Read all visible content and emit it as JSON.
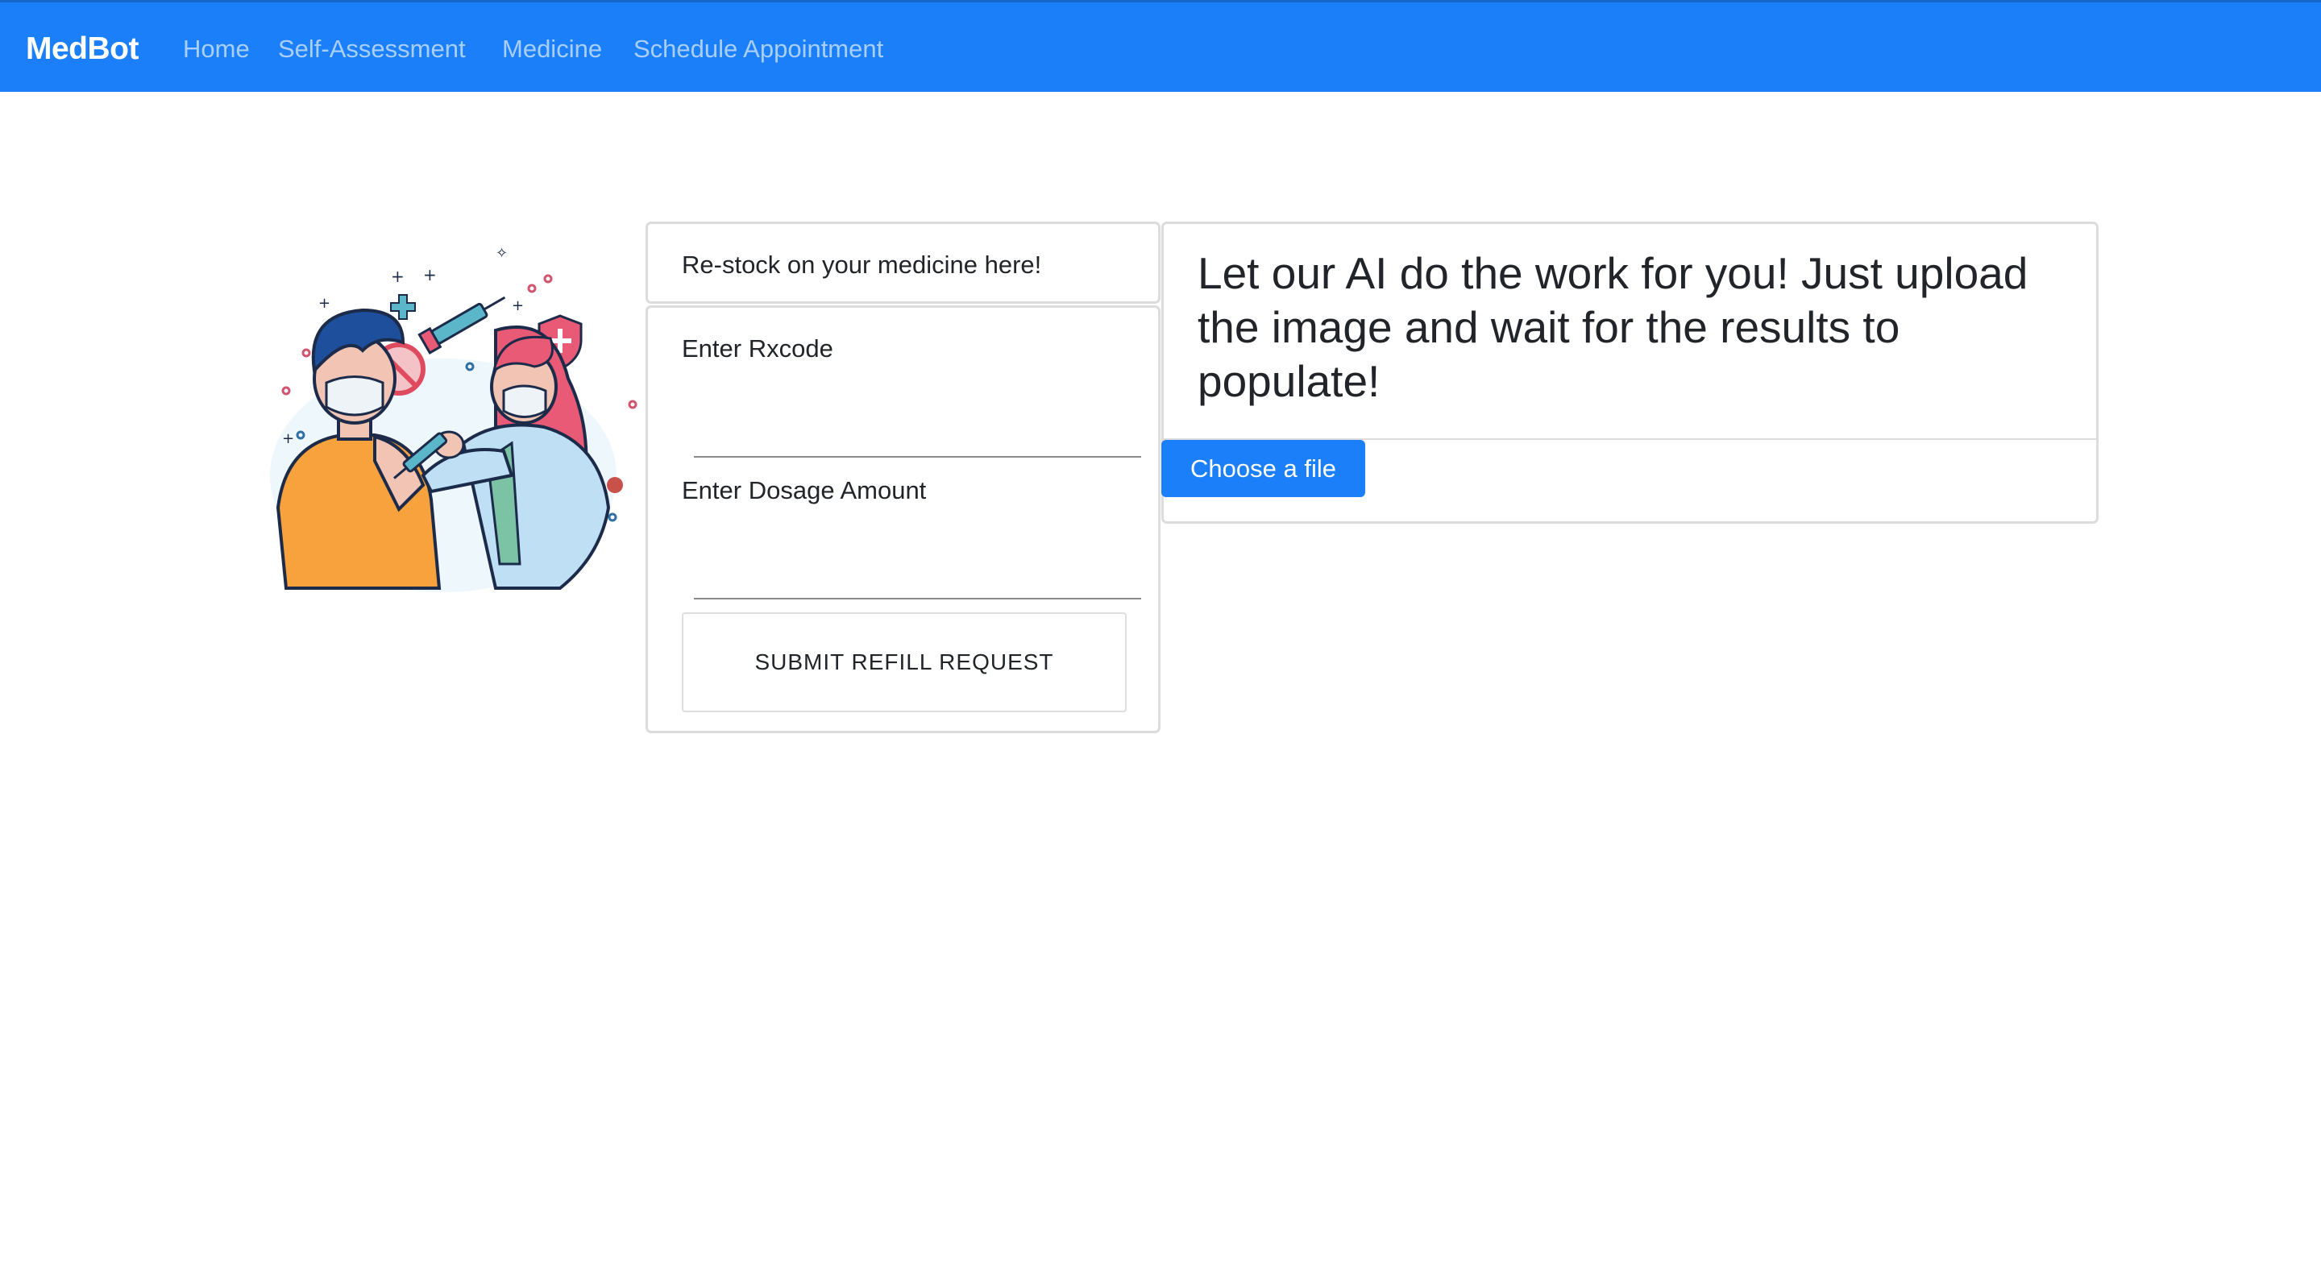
{
  "navbar": {
    "brand": "MedBot",
    "links": [
      "Home",
      "Self-Assessment",
      "Medicine",
      "Schedule Appointment"
    ],
    "background_color": "#1a7ff8"
  },
  "illustration": {
    "description_icon": "vaccination-illustration-icon"
  },
  "refill_card": {
    "header": "Re-stock on your medicine here!",
    "rxcode_label": "Enter Rxcode",
    "rxcode_value": "",
    "dosage_label": "Enter Dosage Amount",
    "dosage_value": "",
    "submit_label": "SUBMIT REFILL REQUEST"
  },
  "ai_card": {
    "text": "Let our AI do the work for you! Just upload the image and wait for the results to populate!",
    "choose_file_label": "Choose a file",
    "accent_color": "#1a7ff8"
  }
}
